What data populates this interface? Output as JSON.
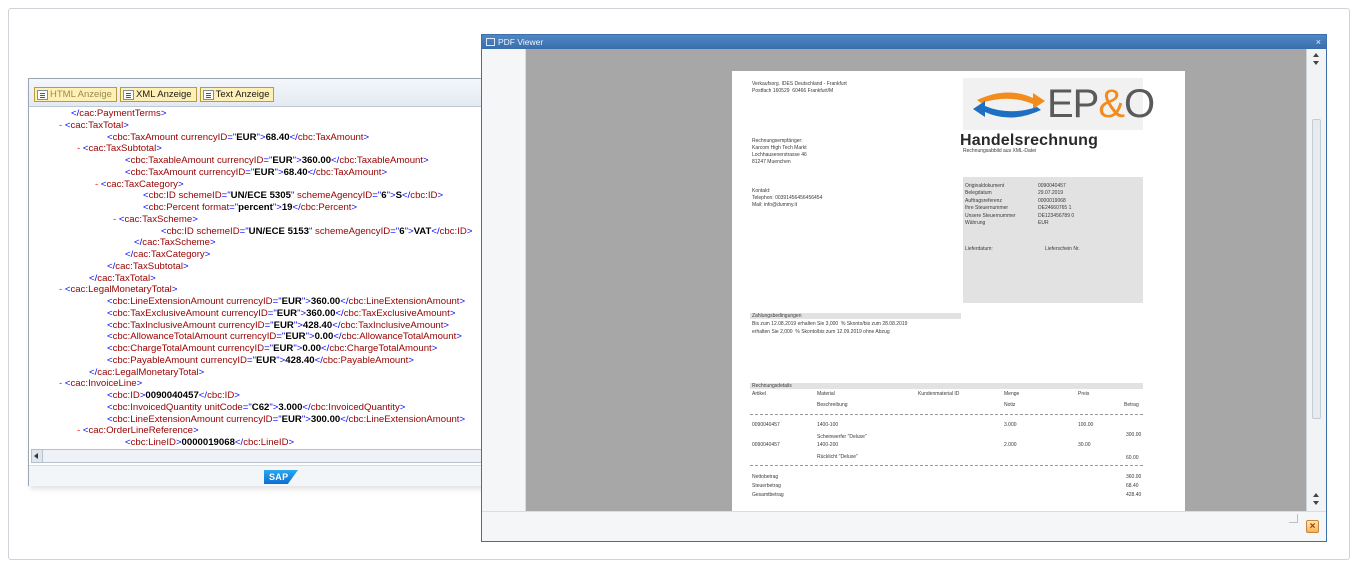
{
  "xml_panel": {
    "tabs": [
      {
        "label": "HTML Anzeige"
      },
      {
        "label": "XML Anzeige"
      },
      {
        "label": "Text Anzeige"
      }
    ],
    "lines": [
      {
        "indent": 0,
        "minus": false,
        "parts": [
          [
            "b",
            "</"
          ],
          [
            "t",
            "cac:PaymentTerms"
          ],
          [
            "b",
            ">"
          ]
        ]
      },
      {
        "indent": 0,
        "minus": true,
        "parts": [
          [
            "b",
            "<"
          ],
          [
            "t",
            "cac:TaxTotal"
          ],
          [
            "b",
            ">"
          ]
        ]
      },
      {
        "indent": 2,
        "minus": false,
        "parts": [
          [
            "b",
            "<"
          ],
          [
            "t",
            "cbc:TaxAmount "
          ],
          [
            "a",
            "currencyID"
          ],
          [
            "b",
            "=\""
          ],
          [
            "v",
            "EUR"
          ],
          [
            "b",
            "\">"
          ],
          [
            "v",
            "68.40"
          ],
          [
            "b",
            "</"
          ],
          [
            "t",
            "cbc:TaxAmount"
          ],
          [
            "b",
            ">"
          ]
        ]
      },
      {
        "indent": 1,
        "minus": true,
        "parts": [
          [
            "b",
            "<"
          ],
          [
            "t",
            "cac:TaxSubtotal"
          ],
          [
            "b",
            ">"
          ]
        ]
      },
      {
        "indent": 3,
        "minus": false,
        "parts": [
          [
            "b",
            "<"
          ],
          [
            "t",
            "cbc:TaxableAmount "
          ],
          [
            "a",
            "currencyID"
          ],
          [
            "b",
            "=\""
          ],
          [
            "v",
            "EUR"
          ],
          [
            "b",
            "\">"
          ],
          [
            "v",
            "360.00"
          ],
          [
            "b",
            "</"
          ],
          [
            "t",
            "cbc:TaxableAmount"
          ],
          [
            "b",
            ">"
          ]
        ]
      },
      {
        "indent": 3,
        "minus": false,
        "parts": [
          [
            "b",
            "<"
          ],
          [
            "t",
            "cbc:TaxAmount "
          ],
          [
            "a",
            "currencyID"
          ],
          [
            "b",
            "=\""
          ],
          [
            "v",
            "EUR"
          ],
          [
            "b",
            "\">"
          ],
          [
            "v",
            "68.40"
          ],
          [
            "b",
            "</"
          ],
          [
            "t",
            "cbc:TaxAmount"
          ],
          [
            "b",
            ">"
          ]
        ]
      },
      {
        "indent": 2,
        "minus": true,
        "parts": [
          [
            "b",
            "<"
          ],
          [
            "t",
            "cac:TaxCategory"
          ],
          [
            "b",
            ">"
          ]
        ]
      },
      {
        "indent": 4,
        "minus": false,
        "parts": [
          [
            "b",
            "<"
          ],
          [
            "t",
            "cbc:ID "
          ],
          [
            "a",
            "schemeID"
          ],
          [
            "b",
            "=\""
          ],
          [
            "v",
            "UN/ECE 5305"
          ],
          [
            "b",
            "\" "
          ],
          [
            "a",
            "schemeAgencyID"
          ],
          [
            "b",
            "=\""
          ],
          [
            "v",
            "6"
          ],
          [
            "b",
            "\">"
          ],
          [
            "v",
            "S"
          ],
          [
            "b",
            "</"
          ],
          [
            "t",
            "cbc:ID"
          ],
          [
            "b",
            ">"
          ]
        ]
      },
      {
        "indent": 4,
        "minus": false,
        "parts": [
          [
            "b",
            "<"
          ],
          [
            "t",
            "cbc:Percent "
          ],
          [
            "a",
            "format"
          ],
          [
            "b",
            "=\""
          ],
          [
            "v",
            "percent"
          ],
          [
            "b",
            "\">"
          ],
          [
            "v",
            "19"
          ],
          [
            "b",
            "</"
          ],
          [
            "t",
            "cbc:Percent"
          ],
          [
            "b",
            ">"
          ]
        ]
      },
      {
        "indent": 3,
        "minus": true,
        "parts": [
          [
            "b",
            "<"
          ],
          [
            "t",
            "cac:TaxScheme"
          ],
          [
            "b",
            ">"
          ]
        ]
      },
      {
        "indent": 5,
        "minus": false,
        "parts": [
          [
            "b",
            "<"
          ],
          [
            "t",
            "cbc:ID "
          ],
          [
            "a",
            "schemeID"
          ],
          [
            "b",
            "=\""
          ],
          [
            "v",
            "UN/ECE 5153"
          ],
          [
            "b",
            "\" "
          ],
          [
            "a",
            "schemeAgencyID"
          ],
          [
            "b",
            "=\""
          ],
          [
            "v",
            "6"
          ],
          [
            "b",
            "\">"
          ],
          [
            "v",
            "VAT"
          ],
          [
            "b",
            "</"
          ],
          [
            "t",
            "cbc:ID"
          ],
          [
            "b",
            ">"
          ]
        ]
      },
      {
        "indent": 3.5,
        "minus": false,
        "parts": [
          [
            "b",
            "</"
          ],
          [
            "t",
            "cac:TaxScheme"
          ],
          [
            "b",
            ">"
          ]
        ]
      },
      {
        "indent": 3,
        "minus": false,
        "parts": [
          [
            "b",
            "</"
          ],
          [
            "t",
            "cac:TaxCategory"
          ],
          [
            "b",
            ">"
          ]
        ]
      },
      {
        "indent": 2,
        "minus": false,
        "parts": [
          [
            "b",
            "</"
          ],
          [
            "t",
            "cac:TaxSubtotal"
          ],
          [
            "b",
            ">"
          ]
        ]
      },
      {
        "indent": 1,
        "minus": false,
        "parts": [
          [
            "b",
            "</"
          ],
          [
            "t",
            "cac:TaxTotal"
          ],
          [
            "b",
            ">"
          ]
        ]
      },
      {
        "indent": 0,
        "minus": true,
        "parts": [
          [
            "b",
            "<"
          ],
          [
            "t",
            "cac:LegalMonetaryTotal"
          ],
          [
            "b",
            ">"
          ]
        ]
      },
      {
        "indent": 2,
        "minus": false,
        "parts": [
          [
            "b",
            "<"
          ],
          [
            "t",
            "cbc:LineExtensionAmount "
          ],
          [
            "a",
            "currencyID"
          ],
          [
            "b",
            "=\""
          ],
          [
            "v",
            "EUR"
          ],
          [
            "b",
            "\">"
          ],
          [
            "v",
            "360.00"
          ],
          [
            "b",
            "</"
          ],
          [
            "t",
            "cbc:LineExtensionAmount"
          ],
          [
            "b",
            ">"
          ]
        ]
      },
      {
        "indent": 2,
        "minus": false,
        "parts": [
          [
            "b",
            "<"
          ],
          [
            "t",
            "cbc:TaxExclusiveAmount "
          ],
          [
            "a",
            "currencyID"
          ],
          [
            "b",
            "=\""
          ],
          [
            "v",
            "EUR"
          ],
          [
            "b",
            "\">"
          ],
          [
            "v",
            "360.00"
          ],
          [
            "b",
            "</"
          ],
          [
            "t",
            "cbc:TaxExclusiveAmount"
          ],
          [
            "b",
            ">"
          ]
        ]
      },
      {
        "indent": 2,
        "minus": false,
        "parts": [
          [
            "b",
            "<"
          ],
          [
            "t",
            "cbc:TaxInclusiveAmount "
          ],
          [
            "a",
            "currencyID"
          ],
          [
            "b",
            "=\""
          ],
          [
            "v",
            "EUR"
          ],
          [
            "b",
            "\">"
          ],
          [
            "v",
            "428.40"
          ],
          [
            "b",
            "</"
          ],
          [
            "t",
            "cbc:TaxInclusiveAmount"
          ],
          [
            "b",
            ">"
          ]
        ]
      },
      {
        "indent": 2,
        "minus": false,
        "parts": [
          [
            "b",
            "<"
          ],
          [
            "t",
            "cbc:AllowanceTotalAmount "
          ],
          [
            "a",
            "currencyID"
          ],
          [
            "b",
            "=\""
          ],
          [
            "v",
            "EUR"
          ],
          [
            "b",
            "\">"
          ],
          [
            "v",
            "0.00"
          ],
          [
            "b",
            "</"
          ],
          [
            "t",
            "cbc:AllowanceTotalAmount"
          ],
          [
            "b",
            ">"
          ]
        ]
      },
      {
        "indent": 2,
        "minus": false,
        "parts": [
          [
            "b",
            "<"
          ],
          [
            "t",
            "cbc:ChargeTotalAmount "
          ],
          [
            "a",
            "currencyID"
          ],
          [
            "b",
            "=\""
          ],
          [
            "v",
            "EUR"
          ],
          [
            "b",
            "\">"
          ],
          [
            "v",
            "0.00"
          ],
          [
            "b",
            "</"
          ],
          [
            "t",
            "cbc:ChargeTotalAmount"
          ],
          [
            "b",
            ">"
          ]
        ]
      },
      {
        "indent": 2,
        "minus": false,
        "parts": [
          [
            "b",
            "<"
          ],
          [
            "t",
            "cbc:PayableAmount "
          ],
          [
            "a",
            "currencyID"
          ],
          [
            "b",
            "=\""
          ],
          [
            "v",
            "EUR"
          ],
          [
            "b",
            "\">"
          ],
          [
            "v",
            "428.40"
          ],
          [
            "b",
            "</"
          ],
          [
            "t",
            "cbc:PayableAmount"
          ],
          [
            "b",
            ">"
          ]
        ]
      },
      {
        "indent": 1,
        "minus": false,
        "parts": [
          [
            "b",
            "</"
          ],
          [
            "t",
            "cac:LegalMonetaryTotal"
          ],
          [
            "b",
            ">"
          ]
        ]
      },
      {
        "indent": 0,
        "minus": true,
        "parts": [
          [
            "b",
            "<"
          ],
          [
            "t",
            "cac:InvoiceLine"
          ],
          [
            "b",
            ">"
          ]
        ]
      },
      {
        "indent": 2,
        "minus": false,
        "parts": [
          [
            "b",
            "<"
          ],
          [
            "t",
            "cbc:ID"
          ],
          [
            "b",
            ">"
          ],
          [
            "v",
            "0090040457"
          ],
          [
            "b",
            "</"
          ],
          [
            "t",
            "cbc:ID"
          ],
          [
            "b",
            ">"
          ]
        ]
      },
      {
        "indent": 2,
        "minus": false,
        "parts": [
          [
            "b",
            "<"
          ],
          [
            "t",
            "cbc:InvoicedQuantity "
          ],
          [
            "a",
            "unitCode"
          ],
          [
            "b",
            "=\""
          ],
          [
            "v",
            "C62"
          ],
          [
            "b",
            "\">"
          ],
          [
            "v",
            "3.000"
          ],
          [
            "b",
            "</"
          ],
          [
            "t",
            "cbc:InvoicedQuantity"
          ],
          [
            "b",
            ">"
          ]
        ]
      },
      {
        "indent": 2,
        "minus": false,
        "parts": [
          [
            "b",
            "<"
          ],
          [
            "t",
            "cbc:LineExtensionAmount "
          ],
          [
            "a",
            "currencyID"
          ],
          [
            "b",
            "=\""
          ],
          [
            "v",
            "EUR"
          ],
          [
            "b",
            "\">"
          ],
          [
            "v",
            "300.00"
          ],
          [
            "b",
            "</"
          ],
          [
            "t",
            "cbc:LineExtensionAmount"
          ],
          [
            "b",
            ">"
          ]
        ]
      },
      {
        "indent": 1,
        "minus": true,
        "parts": [
          [
            "b",
            "<"
          ],
          [
            "t",
            "cac:OrderLineReference"
          ],
          [
            "b",
            ">"
          ]
        ]
      },
      {
        "indent": 3,
        "minus": false,
        "parts": [
          [
            "b",
            "<"
          ],
          [
            "t",
            "cbc:LineID"
          ],
          [
            "b",
            ">"
          ],
          [
            "v",
            "0000019068"
          ],
          [
            "b",
            "</"
          ],
          [
            "t",
            "cbc:LineID"
          ],
          [
            "b",
            ">"
          ]
        ]
      }
    ],
    "footer_logo": "SAP"
  },
  "colors": {
    "arrow": "#f7941d",
    "titlebar": "#4a80c0",
    "logo_blue": "#1d6fc2",
    "logo_orange": "#f28c1c"
  },
  "pdf_viewer": {
    "title": "PDF Viewer",
    "close": "×"
  },
  "invoice": {
    "sender_line1": "Verkaufsorg. IDES Deutschland - Frankfurt",
    "sender_line2": "Postfach 160529  60466 Frankfurt/M",
    "logo": {
      "text_a": "EP",
      "amp": "&",
      "text_b": "O"
    },
    "title": "Handelsrechnung",
    "subtitle": "Rechnungsabbild aus XML-Datei",
    "recipient_label": "Rechnungsempfänger:",
    "recipient": [
      "Karcom High Tech Markt",
      "Lochhausenerstrasse 46",
      "81247 Muenchen"
    ],
    "contact": [
      "Kontakt:",
      "Telephon: 00391456456456454",
      "Mail: info@dummy.it"
    ],
    "doc_info": [
      {
        "label": "Originaldokument",
        "value": "0090040457"
      },
      {
        "label": "Belegdatum",
        "value": "29.07.2019"
      },
      {
        "label": "Auftragsreferenz",
        "value": "0000019068"
      },
      {
        "label": "Ihre Steuernummer",
        "value": "DE24660765 1"
      },
      {
        "label": "Unsere Steuernummer",
        "value": "DE123456789 0"
      },
      {
        "label": "Währung",
        "value": "EUR"
      }
    ],
    "delivery_label": "Lieferdatum:",
    "delivery_note": "Lieferschein Nr.",
    "payment_header": "Zahlungsbedingungen",
    "payment_lines": [
      "Bis zum 12.08.2019 erhalten Sie 3,000  % Skonto/bis zum 28.08.2019",
      "erhalten Sie 2,000  % Skonto/bis zum 12.09.2019 ohne Abzug"
    ],
    "details_header": "Rechnungsdetails",
    "columns": {
      "artikel": "Artikel",
      "material": "Material",
      "beschreibung": "Beschreibung",
      "kundenmaterial": "Kundenmaterial ID",
      "menge": "Menge",
      "notiz": "Notiz",
      "preis": "Preis",
      "betrag": "Betrag"
    },
    "items": [
      {
        "artikel": "0090040457",
        "material": "1400-100",
        "beschreibung": "Scheinwerfer \"Deluxe\"",
        "menge": "3.000",
        "preis": "100.00",
        "betrag": "300.00"
      },
      {
        "artikel": "0090040457",
        "material": "1400-200",
        "beschreibung": "Rücklicht \"Deluxe\"",
        "menge": "2.000",
        "preis": "30.00",
        "betrag": "60.00"
      }
    ],
    "totals": [
      {
        "label": "Nettobetrag",
        "value": "360.00"
      },
      {
        "label": "Steuerbetrag",
        "value": "68.40"
      },
      {
        "label": "Gesamtbetrag",
        "value": "428.40"
      }
    ]
  }
}
